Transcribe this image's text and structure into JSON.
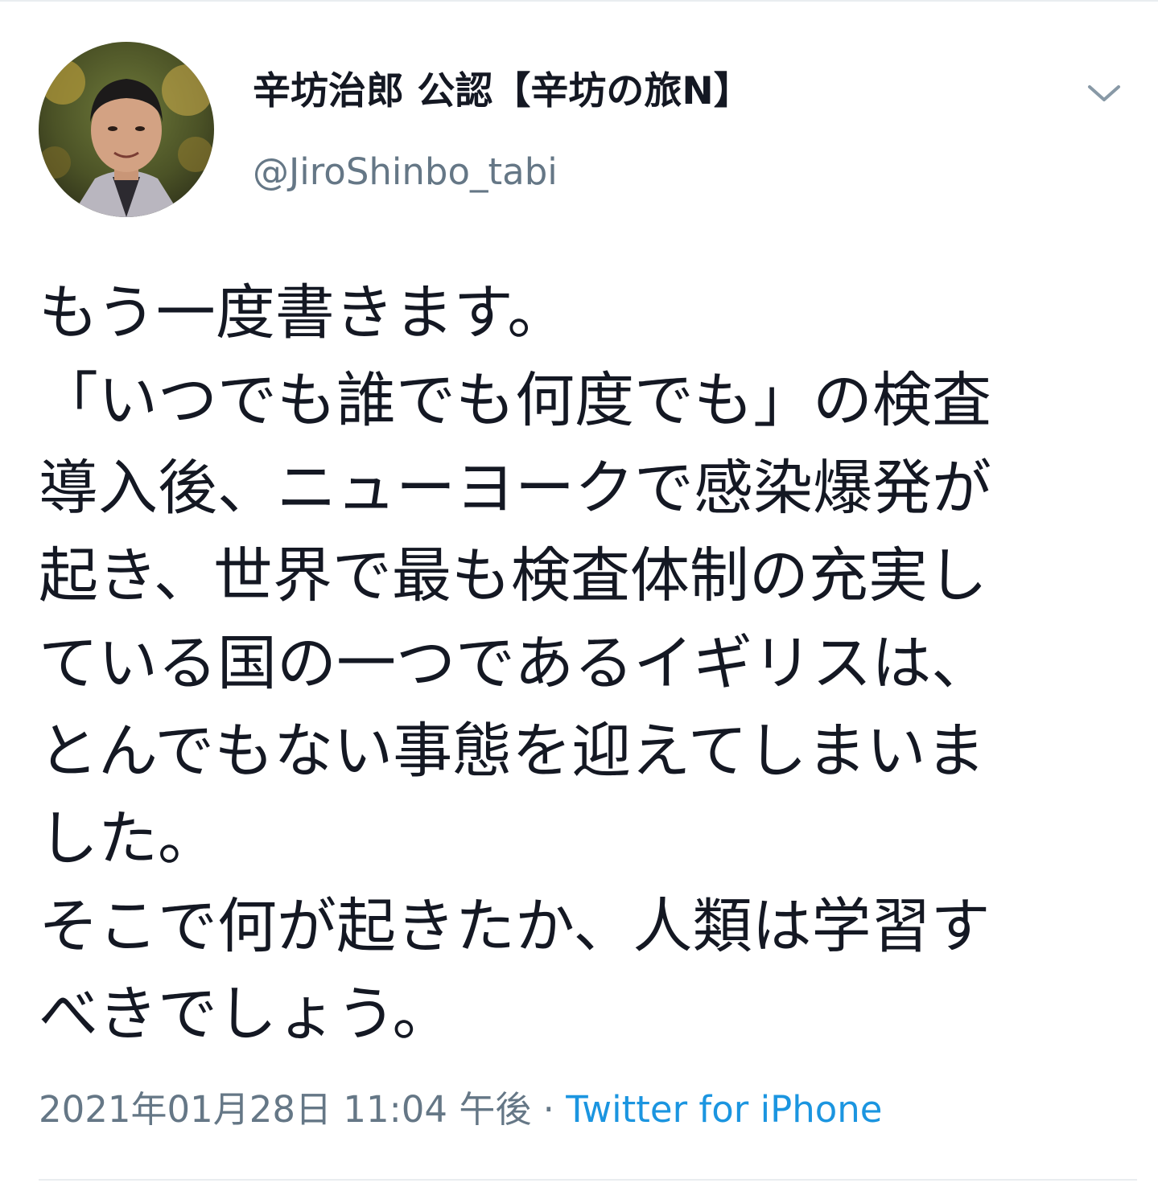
{
  "tweet": {
    "author": {
      "display_name": "辛坊治郎 公認【辛坊の旅N】",
      "handle": "@JiroShinbo_tabi"
    },
    "body_lines": [
      "もう一度書きます。",
      "「いつでも誰でも何度でも」の検査",
      "導入後、ニューヨークで感染爆発が",
      "起き、世界で最も検査体制の充実し",
      "ている国の一つであるイギリスは、",
      "とんでもない事態を迎えてしまいま",
      "した。",
      "そこで何が起きたか、人類は学習す",
      "べきでしょう。"
    ],
    "timestamp": "2021年01月28日 11:04 午後",
    "separator": " · ",
    "source": "Twitter for iPhone"
  },
  "icons": {
    "menu": "chevron-down-icon",
    "avatar": "profile-photo"
  },
  "colors": {
    "text": "#141823",
    "secondary": "#657786",
    "link": "#1b95e0",
    "divider": "#e9edf0"
  }
}
